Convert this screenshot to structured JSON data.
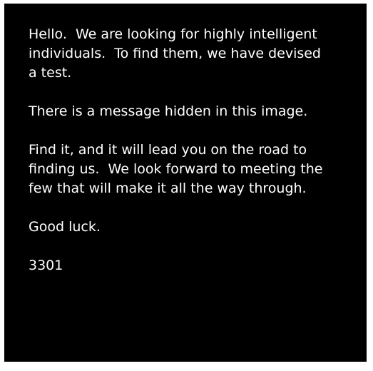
{
  "colors": {
    "page_border": "#ffffff",
    "background": "#000000",
    "text": "#ffffff"
  },
  "message": {
    "p1": "Hello.  We are looking for highly intelligent\nindividuals.  To find them, we have devised\na test.",
    "p2": "There is a message hidden in this image.",
    "p3": "Find it, and it will lead you on the road to\nfinding us.  We look forward to meeting the\nfew that will make it all the way through.",
    "p4": "Good luck.",
    "signature": "3301"
  }
}
